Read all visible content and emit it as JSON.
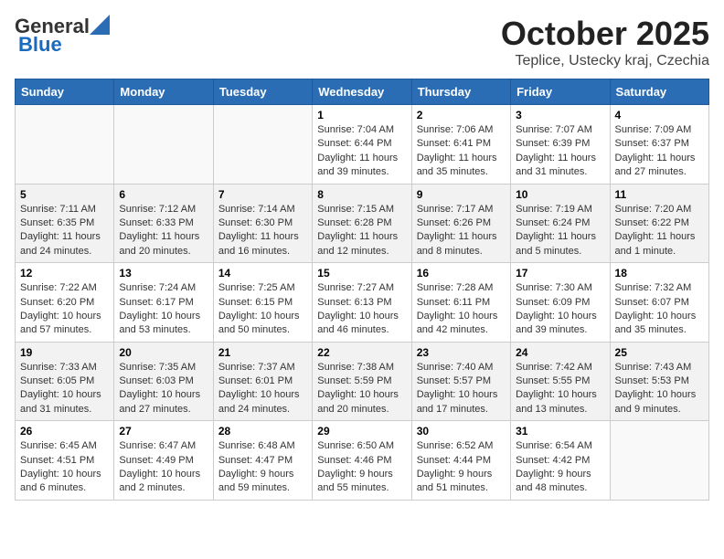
{
  "header": {
    "logo_general": "General",
    "logo_blue": "Blue",
    "title": "October 2025",
    "subtitle": "Teplice, Ustecky kraj, Czechia"
  },
  "days_of_week": [
    "Sunday",
    "Monday",
    "Tuesday",
    "Wednesday",
    "Thursday",
    "Friday",
    "Saturday"
  ],
  "weeks": [
    [
      {
        "day": "",
        "info": ""
      },
      {
        "day": "",
        "info": ""
      },
      {
        "day": "",
        "info": ""
      },
      {
        "day": "1",
        "info": "Sunrise: 7:04 AM\nSunset: 6:44 PM\nDaylight: 11 hours and 39 minutes."
      },
      {
        "day": "2",
        "info": "Sunrise: 7:06 AM\nSunset: 6:41 PM\nDaylight: 11 hours and 35 minutes."
      },
      {
        "day": "3",
        "info": "Sunrise: 7:07 AM\nSunset: 6:39 PM\nDaylight: 11 hours and 31 minutes."
      },
      {
        "day": "4",
        "info": "Sunrise: 7:09 AM\nSunset: 6:37 PM\nDaylight: 11 hours and 27 minutes."
      }
    ],
    [
      {
        "day": "5",
        "info": "Sunrise: 7:11 AM\nSunset: 6:35 PM\nDaylight: 11 hours and 24 minutes."
      },
      {
        "day": "6",
        "info": "Sunrise: 7:12 AM\nSunset: 6:33 PM\nDaylight: 11 hours and 20 minutes."
      },
      {
        "day": "7",
        "info": "Sunrise: 7:14 AM\nSunset: 6:30 PM\nDaylight: 11 hours and 16 minutes."
      },
      {
        "day": "8",
        "info": "Sunrise: 7:15 AM\nSunset: 6:28 PM\nDaylight: 11 hours and 12 minutes."
      },
      {
        "day": "9",
        "info": "Sunrise: 7:17 AM\nSunset: 6:26 PM\nDaylight: 11 hours and 8 minutes."
      },
      {
        "day": "10",
        "info": "Sunrise: 7:19 AM\nSunset: 6:24 PM\nDaylight: 11 hours and 5 minutes."
      },
      {
        "day": "11",
        "info": "Sunrise: 7:20 AM\nSunset: 6:22 PM\nDaylight: 11 hours and 1 minute."
      }
    ],
    [
      {
        "day": "12",
        "info": "Sunrise: 7:22 AM\nSunset: 6:20 PM\nDaylight: 10 hours and 57 minutes."
      },
      {
        "day": "13",
        "info": "Sunrise: 7:24 AM\nSunset: 6:17 PM\nDaylight: 10 hours and 53 minutes."
      },
      {
        "day": "14",
        "info": "Sunrise: 7:25 AM\nSunset: 6:15 PM\nDaylight: 10 hours and 50 minutes."
      },
      {
        "day": "15",
        "info": "Sunrise: 7:27 AM\nSunset: 6:13 PM\nDaylight: 10 hours and 46 minutes."
      },
      {
        "day": "16",
        "info": "Sunrise: 7:28 AM\nSunset: 6:11 PM\nDaylight: 10 hours and 42 minutes."
      },
      {
        "day": "17",
        "info": "Sunrise: 7:30 AM\nSunset: 6:09 PM\nDaylight: 10 hours and 39 minutes."
      },
      {
        "day": "18",
        "info": "Sunrise: 7:32 AM\nSunset: 6:07 PM\nDaylight: 10 hours and 35 minutes."
      }
    ],
    [
      {
        "day": "19",
        "info": "Sunrise: 7:33 AM\nSunset: 6:05 PM\nDaylight: 10 hours and 31 minutes."
      },
      {
        "day": "20",
        "info": "Sunrise: 7:35 AM\nSunset: 6:03 PM\nDaylight: 10 hours and 27 minutes."
      },
      {
        "day": "21",
        "info": "Sunrise: 7:37 AM\nSunset: 6:01 PM\nDaylight: 10 hours and 24 minutes."
      },
      {
        "day": "22",
        "info": "Sunrise: 7:38 AM\nSunset: 5:59 PM\nDaylight: 10 hours and 20 minutes."
      },
      {
        "day": "23",
        "info": "Sunrise: 7:40 AM\nSunset: 5:57 PM\nDaylight: 10 hours and 17 minutes."
      },
      {
        "day": "24",
        "info": "Sunrise: 7:42 AM\nSunset: 5:55 PM\nDaylight: 10 hours and 13 minutes."
      },
      {
        "day": "25",
        "info": "Sunrise: 7:43 AM\nSunset: 5:53 PM\nDaylight: 10 hours and 9 minutes."
      }
    ],
    [
      {
        "day": "26",
        "info": "Sunrise: 6:45 AM\nSunset: 4:51 PM\nDaylight: 10 hours and 6 minutes."
      },
      {
        "day": "27",
        "info": "Sunrise: 6:47 AM\nSunset: 4:49 PM\nDaylight: 10 hours and 2 minutes."
      },
      {
        "day": "28",
        "info": "Sunrise: 6:48 AM\nSunset: 4:47 PM\nDaylight: 9 hours and 59 minutes."
      },
      {
        "day": "29",
        "info": "Sunrise: 6:50 AM\nSunset: 4:46 PM\nDaylight: 9 hours and 55 minutes."
      },
      {
        "day": "30",
        "info": "Sunrise: 6:52 AM\nSunset: 4:44 PM\nDaylight: 9 hours and 51 minutes."
      },
      {
        "day": "31",
        "info": "Sunrise: 6:54 AM\nSunset: 4:42 PM\nDaylight: 9 hours and 48 minutes."
      },
      {
        "day": "",
        "info": ""
      }
    ]
  ]
}
